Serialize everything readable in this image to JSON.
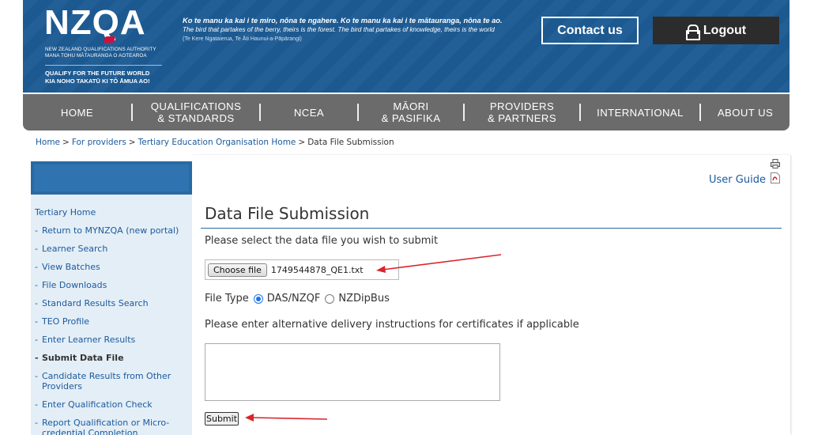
{
  "header": {
    "logo_text": "NZQA",
    "logo_subtitle_1": "NEW ZEALAND QUALIFICATIONS AUTHORITY",
    "logo_subtitle_2": "MANA TOHU MĀTAURANGA O AOTEAROA",
    "logo_tagline_1": "QUALIFY FOR THE FUTURE WORLD",
    "logo_tagline_2": "KIA NOHO TAKATŪ KI TŌ ĀMUA AO!",
    "motto_maori": "Ko te manu ka kai i te miro, nōna te ngahere. Ko te manu ka kai i te mātauranga, nōna te ao.",
    "motto_english": "The bird that partakes of the berry, theirs is the forest. The bird that partakes of knowledge, theirs is the world",
    "motto_attribution": "(Te Kere Ngataierua, Te Āti Haunui-a-Pāpārangi)",
    "contact_label": "Contact us",
    "logout_label": "Logout",
    "brand_color": "#1d5b93"
  },
  "nav": {
    "items": [
      {
        "line1": "HOME",
        "line2": ""
      },
      {
        "line1": "QUALIFICATIONS",
        "line2": "& STANDARDS"
      },
      {
        "line1": "NCEA",
        "line2": ""
      },
      {
        "line1": "MĀORI",
        "line2": "& PASIFIKA"
      },
      {
        "line1": "PROVIDERS",
        "line2": "& PARTNERS"
      },
      {
        "line1": "INTERNATIONAL",
        "line2": ""
      },
      {
        "line1": "ABOUT US",
        "line2": ""
      }
    ]
  },
  "breadcrumb": {
    "home": "Home",
    "providers": "For providers",
    "teo": "Tertiary Education Organisation Home",
    "current": "Data File Submission",
    "separator": ">"
  },
  "sidebar": {
    "title": "Tertiary Home",
    "items": [
      {
        "label": "Return to MYNZQA (new portal)"
      },
      {
        "label": "Learner Search"
      },
      {
        "label": "View Batches"
      },
      {
        "label": "File Downloads"
      },
      {
        "label": "Standard Results Search"
      },
      {
        "label": "TEO Profile"
      },
      {
        "label": "Enter Learner Results"
      },
      {
        "label": "Submit Data File"
      },
      {
        "label": "Candidate Results from Other Providers"
      },
      {
        "label": "Enter Qualification Check"
      },
      {
        "label": "Report Qualification or Micro-credential Completion"
      }
    ],
    "dash": "-"
  },
  "main": {
    "user_guide": "User Guide",
    "title": "Data File Submission",
    "prompt": "Please select the data file you wish to submit",
    "choose_file_label": "Choose file",
    "file_name": "1749544878_QE1.txt",
    "file_type_label": "File Type",
    "file_type_options": [
      "DAS/NZQF",
      "NZDipBus"
    ],
    "file_type_selected": "DAS/NZQF",
    "instructions_label": "Please enter alternative delivery instructions for certificates if applicable",
    "instructions_value": "",
    "submit_label": "Submit"
  }
}
